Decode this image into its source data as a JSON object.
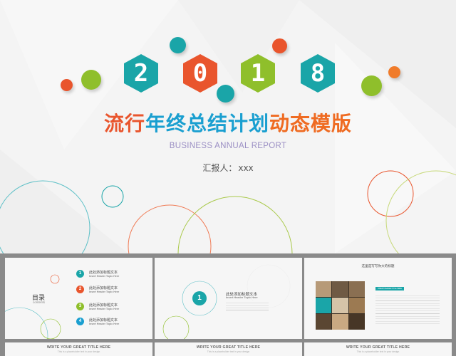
{
  "colors": {
    "teal": "#1aa5a8",
    "red": "#e9552d",
    "green": "#8fbf2b",
    "blue": "#1a9fd0",
    "orange": "#f07b2a",
    "background": "#f4f4f4",
    "gutter": "#8a8a8a"
  },
  "main": {
    "year_digits": [
      "2",
      "0",
      "1",
      "8"
    ],
    "title_parts": [
      {
        "text": "流行",
        "color": "#e9552d"
      },
      {
        "text": "年终总结计划",
        "color": "#1a9fd0"
      },
      {
        "text": "动态模版",
        "color": "#ef6b22"
      }
    ],
    "subtitle": "BUSINESS ANNUAL REPORT",
    "reporter_label": "汇报人：",
    "reporter_value": "xxx"
  },
  "thumb_toc": {
    "title": "目录",
    "title_en": "contents",
    "items": [
      {
        "num": "1",
        "cn": "此处添加标题文本",
        "en": "Insert Header Topic Here",
        "color": "#1aa5a8"
      },
      {
        "num": "2",
        "cn": "此处添加标题文本",
        "en": "Insert Header Topic Here",
        "color": "#e9552d"
      },
      {
        "num": "3",
        "cn": "此处添加标题文本",
        "en": "Insert Header Topic Here",
        "color": "#8fbf2b"
      },
      {
        "num": "4",
        "cn": "此处添加标题文本",
        "en": "Insert Header Topic Here",
        "color": "#1a9fd0"
      }
    ]
  },
  "thumb_section": {
    "num": "1",
    "cn": "此处添加标题文本",
    "en": "Insert Header Topic Here"
  },
  "thumb_photo": {
    "title": "这里是写写你大的标题",
    "caption": "INSERT HEADER TITLE HERE"
  },
  "thumb_bottom": [
    {
      "title": "WRITE YOUR GREAT TITLE HERE",
      "sub": "This is a placeholder text in your design"
    },
    {
      "title": "WRITE YOUR GREAT TITLE HERE",
      "sub": "This is a placeholder text in your design"
    },
    {
      "title": "WRITE YOUR GREAT TITLE HERE",
      "sub": "This is a placeholder text in your design"
    }
  ]
}
